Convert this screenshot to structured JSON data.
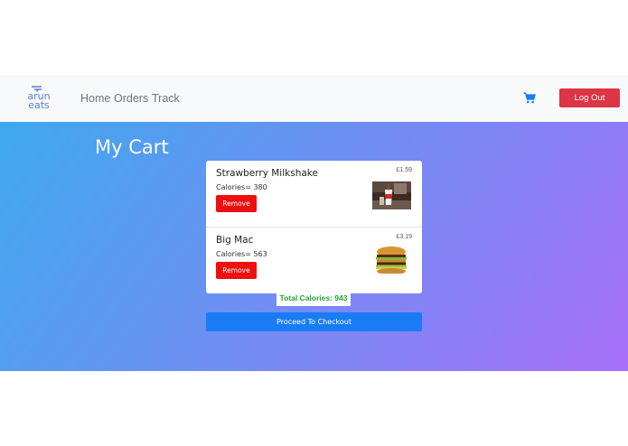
{
  "navbar": {
    "logo": {
      "line1": "arun",
      "line2": "eats"
    },
    "links": [
      "Home",
      "Orders",
      "Track"
    ],
    "cart_icon": "shopping-cart-icon",
    "logout_label": "Log Out"
  },
  "main": {
    "title": "My Cart",
    "items": [
      {
        "name": "Strawberry Milkshake",
        "calories": "Calories= 380",
        "price": "£1.59",
        "remove_label": "Remove",
        "image": "milkshake-image"
      },
      {
        "name": "Big Mac",
        "calories": "Calories= 563",
        "price": "£3.19",
        "remove_label": "Remove",
        "image": "big-mac-image"
      }
    ],
    "total_calories": "Total Calories: 943",
    "checkout_label": "Proceed To Checkout"
  },
  "colors": {
    "navbar_bg": "#f8f9fa",
    "logout": "#dc3545",
    "remove": "#ee0f0f",
    "checkout": "#1a7cf4",
    "total_text": "#1fa335",
    "gradient_start": "#3ea9ee",
    "gradient_end": "#a86ffa"
  }
}
